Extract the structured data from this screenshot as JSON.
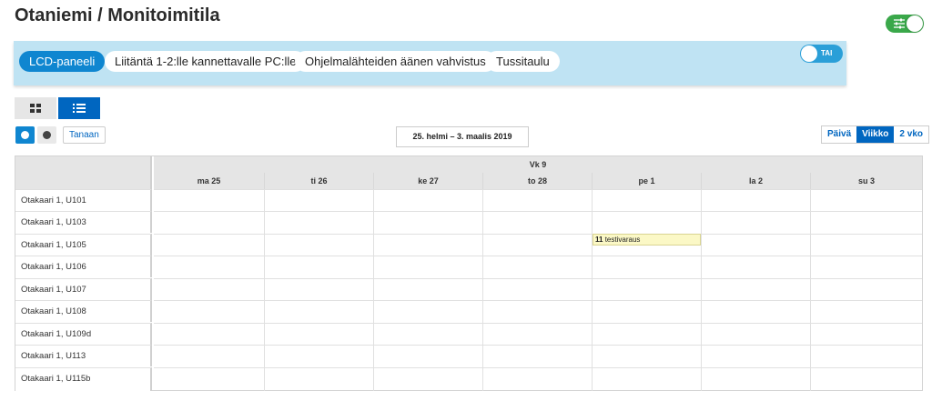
{
  "header": {
    "title": "Otaniemi / Monitoimitila"
  },
  "filters": {
    "chips": [
      {
        "label": "LCD-paneeli",
        "active": true
      },
      {
        "label": "Liitäntä 1-2:lle kannettavalle PC:lle",
        "active": false
      },
      {
        "label": "Ohjelmalähteiden äänen vahvistus",
        "active": false
      },
      {
        "label": "Tussitaulu",
        "active": false
      }
    ],
    "mode_toggle_label": "TAI"
  },
  "toolbar": {
    "today_label": "Tanaan",
    "date_range": "25. helmi – 3. maalis 2019",
    "range_options": [
      {
        "label": "Päivä",
        "active": false
      },
      {
        "label": "Viikko",
        "active": true
      },
      {
        "label": "2 vko",
        "active": false
      }
    ]
  },
  "calendar": {
    "week_label": "Vk 9",
    "days": [
      "ma 25",
      "ti 26",
      "ke 27",
      "to 28",
      "pe 1",
      "la 2",
      "su 3"
    ],
    "resources": [
      "Otakaari 1, U101",
      "Otakaari 1, U103",
      "Otakaari 1, U105",
      "Otakaari 1, U106",
      "Otakaari 1, U107",
      "Otakaari 1, U108",
      "Otakaari 1, U109d",
      "Otakaari 1, U113",
      "Otakaari 1, U115b"
    ],
    "event": {
      "time": "11",
      "title": "testivaraus"
    }
  },
  "colors": {
    "accent": "#0066c0",
    "chip_active": "#0f86d0",
    "filter_bar": "#bfe3f3",
    "toggle_on": "#3aa84a",
    "event_bg": "#fbf8c6"
  },
  "icons": {
    "settings_toggle": "sliders-icon",
    "grid_view": "grid-icon",
    "list_view": "list-icon",
    "prev": "arrow-left-icon",
    "next": "arrow-right-icon"
  }
}
